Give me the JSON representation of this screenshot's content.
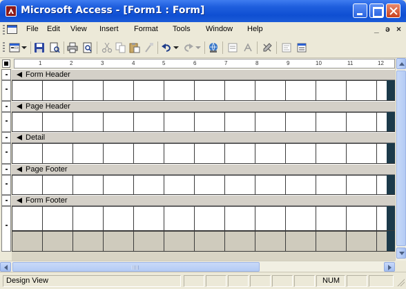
{
  "window": {
    "title": "Microsoft Access - [Form1 : Form]"
  },
  "menubar": {
    "items": [
      "File",
      "Edit",
      "View",
      "Insert",
      "Format",
      "Tools",
      "Window",
      "Help"
    ],
    "minimize_glyph": "_",
    "restore_glyph": "ə",
    "close_glyph": "×"
  },
  "toolbar": {
    "icons": [
      "form-view-icon",
      "dropdown-arrow-icon",
      "save-icon",
      "file-search-icon",
      "print-icon",
      "print-preview-icon",
      "cut-icon",
      "copy-icon",
      "paste-icon",
      "format-painter-icon",
      "undo-icon",
      "undo-dropdown-icon",
      "redo-icon",
      "redo-dropdown-icon",
      "insert-hyperlink-icon",
      "field-list-icon",
      "toolbox-icon",
      "autoformat-icon",
      "code-icon",
      "properties-icon"
    ]
  },
  "ruler": {
    "marks": [
      "1",
      "2",
      "3",
      "4",
      "5",
      "6",
      "7",
      "8",
      "9",
      "10",
      "11",
      "12"
    ]
  },
  "sections": [
    {
      "label": "Form Header"
    },
    {
      "label": "Page Header"
    },
    {
      "label": "Detail"
    },
    {
      "label": "Page Footer"
    },
    {
      "label": "Form Footer"
    }
  ],
  "status": {
    "text": "Design View",
    "num": "NUM"
  },
  "colors": {
    "titlebar": "#0f4fd2",
    "chrome": "#ece9d8",
    "grid_line": "#3a3a3a"
  }
}
